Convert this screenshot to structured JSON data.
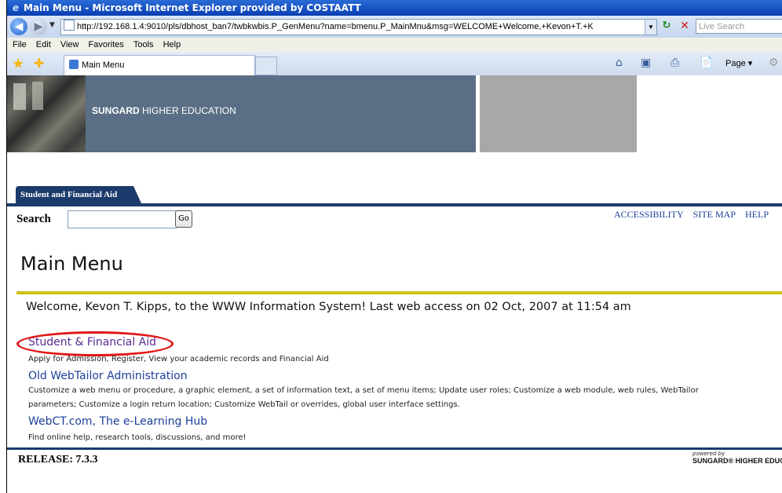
{
  "window": {
    "title": "Main Menu - Microsoft Internet Explorer provided by COSTAATT"
  },
  "address": {
    "url": "http://192.168.1.4:9010/pls/dbhost_ban7/twbkwbis.P_GenMenu?name=bmenu.P_MainMnu&msg=WELCOME+Welcome,+Kevon+T.+K",
    "search_placeholder": "Live Search"
  },
  "menu": [
    "File",
    "Edit",
    "View",
    "Favorites",
    "Tools",
    "Help"
  ],
  "browser_tab": {
    "label": "Main Menu"
  },
  "toolbar": {
    "page_label": "Page ▾"
  },
  "banner": {
    "brand": "SUNGARD",
    "brand_sub": "HIGHER EDUCATION"
  },
  "nav_tab": {
    "label": "Student and Financial Aid"
  },
  "search": {
    "label": "Search",
    "value": "",
    "go_label": "Go"
  },
  "top_links": [
    "ACCESSIBILITY",
    "SITE MAP",
    "HELP"
  ],
  "page_title": "Main Menu",
  "welcome_text": "Welcome, Kevon T. Kipps, to the WWW Information System! Last web access on 02 Oct, 2007 at 11:54 am",
  "menu_items": [
    {
      "title": "Student & Financial Aid",
      "description": "Apply for Admission, Register, View your academic records and Financial Aid"
    },
    {
      "title": "Old WebTailor Administration",
      "description_1": "Customize a web menu or procedure, a graphic element, a set of information text, a set of menu items; Update user roles; Customize a web module, web rules, WebTailor",
      "description_2": "parameters; Customize a login return location; Customize WebTail or overrides, global user interface settings."
    },
    {
      "title": "WebCT.com, The e-Learning Hub",
      "description": "Find online help, research tools, discussions, and more!"
    }
  ],
  "footer": {
    "release": "RELEASE: 7.3.3",
    "powered_by": "powered by",
    "logo_text": "SUNGARD® HIGHER EDUCAT"
  },
  "colors": {
    "nav_blue": "#1b3b6c",
    "banner_slate": "#5a6f85",
    "accent_yellow": "#c9c317",
    "link_blue": "#1d3f9a",
    "highlight_red": "#e01515"
  }
}
